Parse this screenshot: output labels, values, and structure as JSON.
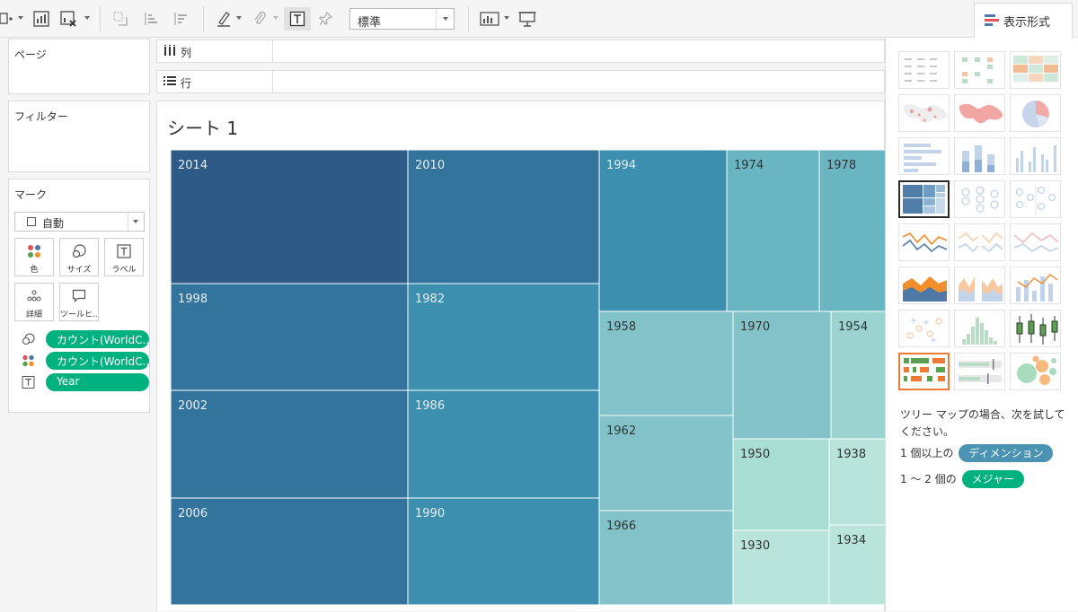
{
  "toolbar": {
    "fit_value": "標準",
    "showme_label": "表示形式"
  },
  "left_panel": {
    "pages_title": "ページ",
    "filters_title": "フィルター",
    "marks_title": "マーク",
    "marks_type": "自動",
    "mark_buttons": {
      "color": "色",
      "size": "サイズ",
      "label": "ラベル",
      "detail": "詳細",
      "tooltip": "ツールヒ..."
    },
    "mark_pills": [
      {
        "icon": "size-icon",
        "text": "カウント(WorldC.."
      },
      {
        "icon": "color-icon",
        "text": "カウント(WorldC.."
      },
      {
        "icon": "label-icon",
        "text": "Year"
      }
    ]
  },
  "shelves": {
    "columns_label": "列",
    "rows_label": "行"
  },
  "sheet": {
    "title": "シート 1"
  },
  "treemap": {
    "cells": [
      {
        "label": "2014",
        "value": 7,
        "color": "#2e5a87"
      },
      {
        "label": "2010",
        "value": 6,
        "color": "#33749d"
      },
      {
        "label": "1998",
        "value": 6,
        "color": "#33749d"
      },
      {
        "label": "1982",
        "value": 5,
        "color": "#3d8fb0"
      },
      {
        "label": "2002",
        "value": 6,
        "color": "#33749d"
      },
      {
        "label": "1986",
        "value": 5,
        "color": "#3d8fb0"
      },
      {
        "label": "2006",
        "value": 6,
        "color": "#33749d"
      },
      {
        "label": "1990",
        "value": 5,
        "color": "#3d8fb0"
      },
      {
        "label": "1994",
        "value": 5,
        "color": "#3d8fb0"
      },
      {
        "label": "1974",
        "value": 4,
        "color": "#6ab5c2"
      },
      {
        "label": "1978",
        "value": 4,
        "color": "#6ab5c2"
      },
      {
        "label": "1958",
        "value": 4,
        "color": "#82c3c9"
      },
      {
        "label": "1970",
        "value": 4,
        "color": "#82c3c9"
      },
      {
        "label": "1954",
        "value": 3,
        "color": "#9ad3d0"
      },
      {
        "label": "1962",
        "value": 3,
        "color": "#82c3c9"
      },
      {
        "label": "1950",
        "value": 2,
        "color": "#a8ddd4"
      },
      {
        "label": "1938",
        "value": 2,
        "color": "#b8e4da"
      },
      {
        "label": "1966",
        "value": 3,
        "color": "#82c3c9"
      },
      {
        "label": "1930",
        "value": 2,
        "color": "#b8e4da"
      },
      {
        "label": "1934",
        "value": 2,
        "color": "#b8e4da"
      }
    ]
  },
  "showme": {
    "hint_text": "ツリー マップの場合、次を試してください。",
    "req1_prefix": "1 個以上の",
    "req1_tag": "ディメンション",
    "req2_prefix": "1 〜 2 個の",
    "req2_tag": "メジャー",
    "dimension_color": "#4a93b3",
    "measure_color": "#00b180"
  }
}
